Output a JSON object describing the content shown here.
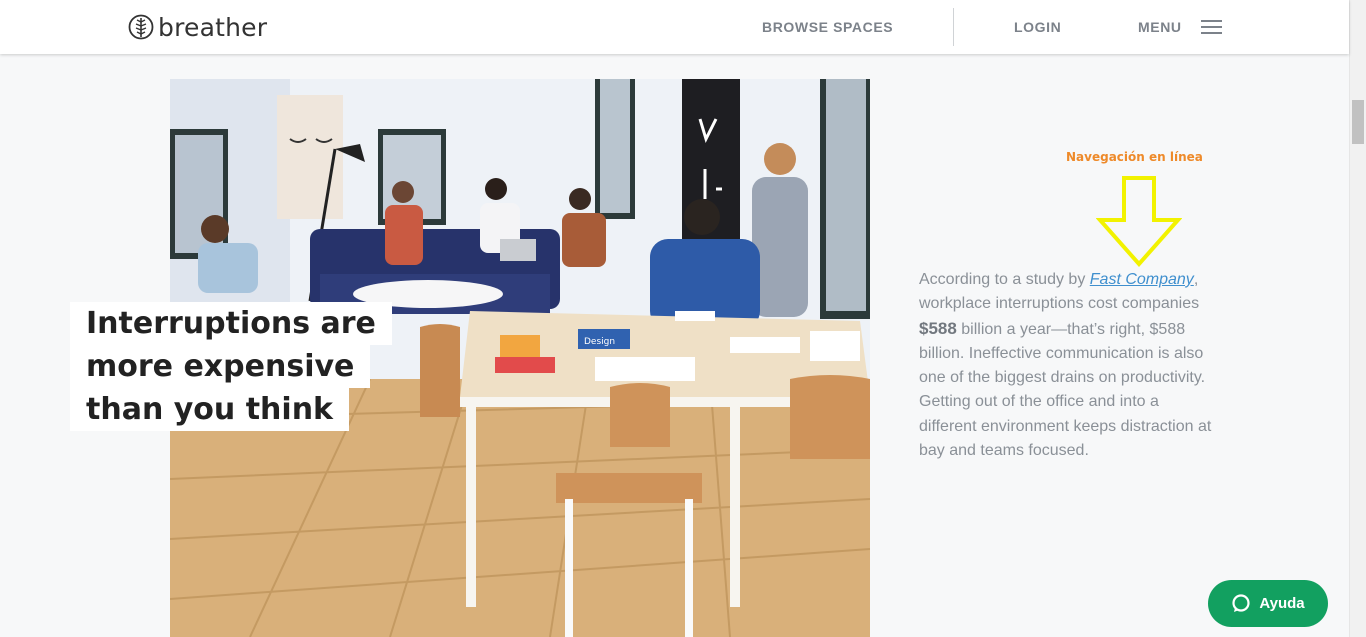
{
  "header": {
    "logo_text": "breather",
    "nav": {
      "browse": "BROWSE SPACES",
      "login": "LOGIN",
      "menu": "MENU"
    }
  },
  "hero": {
    "headline_lines": [
      "Interruptions are",
      "more expensive",
      "than you think"
    ],
    "book_label": "Design"
  },
  "annotation": {
    "label": "Navegación en línea",
    "color": "#ee8a2a",
    "arrow_color": "#f2f200"
  },
  "article": {
    "p1_pre": "According to a study by ",
    "p1_link": "Fast Company",
    "p1_post": ", workplace interruptions cost companies ",
    "p1_amount": "$588",
    "p1_rest": " billion a year—that’s right, $588 billion. Ineffective communication is also one of the biggest drains on productivity. Getting out of the office and into a different environment keeps distraction at bay and teams focused."
  },
  "help_button": {
    "label": "Ayuda",
    "color": "#12a060"
  }
}
